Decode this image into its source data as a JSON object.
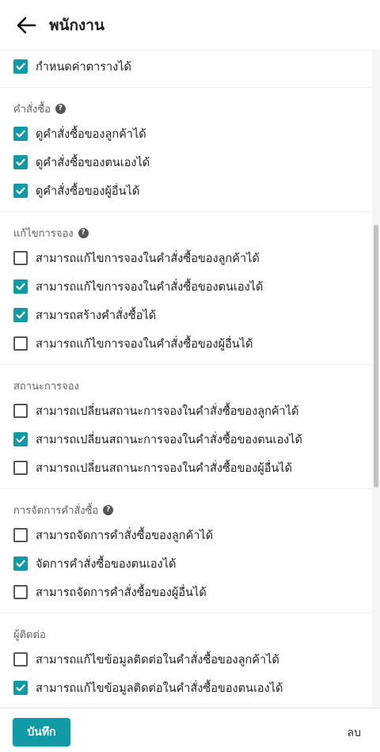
{
  "header": {
    "title": "พนักงาน",
    "back_icon": "arrow-left-icon"
  },
  "top_item": {
    "label": "กำหนดค่าตารางได้",
    "checked": true
  },
  "sections": [
    {
      "title": "คำสั่งซื้อ",
      "help": true,
      "items": [
        {
          "label": "ดูคำสั่งซื้อของลูกค้าได้",
          "checked": true
        },
        {
          "label": "ดูคำสั่งซื้อของตนเองได้",
          "checked": true
        },
        {
          "label": "ดูคำสั่งซื้อของผู้อื่นได้",
          "checked": true
        }
      ]
    },
    {
      "title": "แก้ไขการจอง",
      "help": true,
      "items": [
        {
          "label": "สามารถแก้ไขการจองในคำสั่งซื้อของลูกค้าได้",
          "checked": false
        },
        {
          "label": "สามารถแก้ไขการจองในคำสั่งซื้อของตนเองได้",
          "checked": true
        },
        {
          "label": "สามารถสร้างคำสั่งซื้อได้",
          "checked": true
        },
        {
          "label": "สามารถแก้ไขการจองในคำสั่งซื้อของผู้อื่นได้",
          "checked": false
        }
      ]
    },
    {
      "title": "สถานะการจอง",
      "help": false,
      "items": [
        {
          "label": "สามารถเปลี่ยนสถานะการจองในคำสั่งซื้อของลูกค้าได้",
          "checked": false
        },
        {
          "label": "สามารถเปลี่ยนสถานะการจองในคำสั่งซื้อของตนเองได้",
          "checked": true
        },
        {
          "label": "สามารถเปลี่ยนสถานะการจองในคำสั่งซื้อของผู้อื่นได้",
          "checked": false
        }
      ]
    },
    {
      "title": "การจัดการคำสั่งซื้อ",
      "help": true,
      "items": [
        {
          "label": "สามารถจัดการคำสั่งซื้อของลูกค้าได้",
          "checked": false
        },
        {
          "label": "จัดการคำสั่งซื้อของตนเองได้",
          "checked": true
        },
        {
          "label": "สามารถจัดการคำสั่งซื้อของผู้อื่นได้",
          "checked": false
        }
      ]
    },
    {
      "title": "ผู้ติดต่อ",
      "help": false,
      "items": [
        {
          "label": "สามารถแก้ไขข้อมูลติดต่อในคำสั่งซื้อของลูกค้าได้",
          "checked": false
        },
        {
          "label": "สามารถแก้ไขข้อมูลติดต่อในคำสั่งซื้อของตนเองได้",
          "checked": true
        }
      ]
    }
  ],
  "footer": {
    "save_label": "บันทึก",
    "delete_label": "ลบ"
  },
  "colors": {
    "accent": "#0f9aa6"
  }
}
